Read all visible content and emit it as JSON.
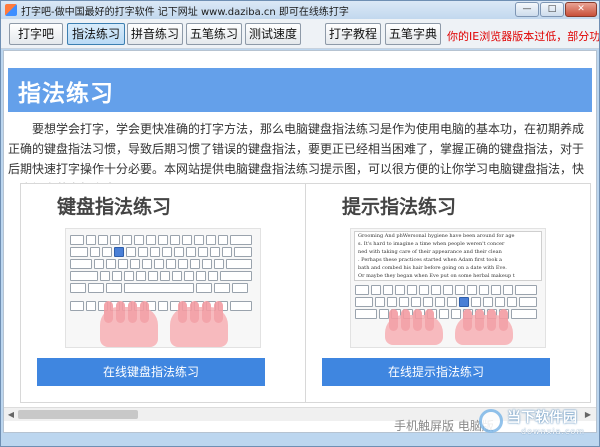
{
  "window": {
    "title": "打字吧-做中国最好的打字软件 记下网址 www.daziba.cn 即可在线练打字",
    "min_glyph": "—",
    "max_glyph": "□",
    "close_glyph": "✕"
  },
  "toolbar": {
    "buttons": [
      {
        "label": "打字吧"
      },
      {
        "label": "指法练习"
      },
      {
        "label": "拼音练习"
      },
      {
        "label": "五笔练习"
      },
      {
        "label": "测试速度"
      },
      {
        "label": "打字教程"
      },
      {
        "label": "五笔字典"
      }
    ],
    "warning": "你的IE浏览器版本过低，部分功能可能无法使用"
  },
  "page": {
    "banner_title": "指法练习",
    "intro": "要想学会打字，学会更快准确的打字方法，那么电脑键盘指法练习是作为使用电脑的基本功，在初期养成正确的键盘指法习惯，导致后期习惯了错误的键盘指法，要更正已经相当困难了，掌握正确的键盘指法，对于后期快速打字操作十分必要。本网站提供电脑键盘指法练习提示图，可以很方便的让你学习电脑键盘指法，快速度提高英文打字水平。",
    "cards": [
      {
        "title": "键盘指法练习",
        "button": "在线键盘指法练习"
      },
      {
        "title": "提示指法练习",
        "button": "在线提示指法练习"
      }
    ],
    "sample_text": [
      "Grooming And phWersonal hygiene have been around for age",
      "s. It's hard to imagine a time when people weren't concer",
      "ned with taking care of their appearance and their clean",
      ". Perhaps these practices started when Adam first took a",
      "bath and combed his hair before going on a date with Eve.",
      " Or maybe they began when Eve put on some herbal makeup t"
    ],
    "footer_text": "手机触屏版   电脑版"
  },
  "watermark": {
    "text": "当下软件园",
    "sub": "downxia.com"
  },
  "colors": {
    "banner": "#64a0ea",
    "button": "#3f86e0",
    "warning": "#e00000"
  }
}
